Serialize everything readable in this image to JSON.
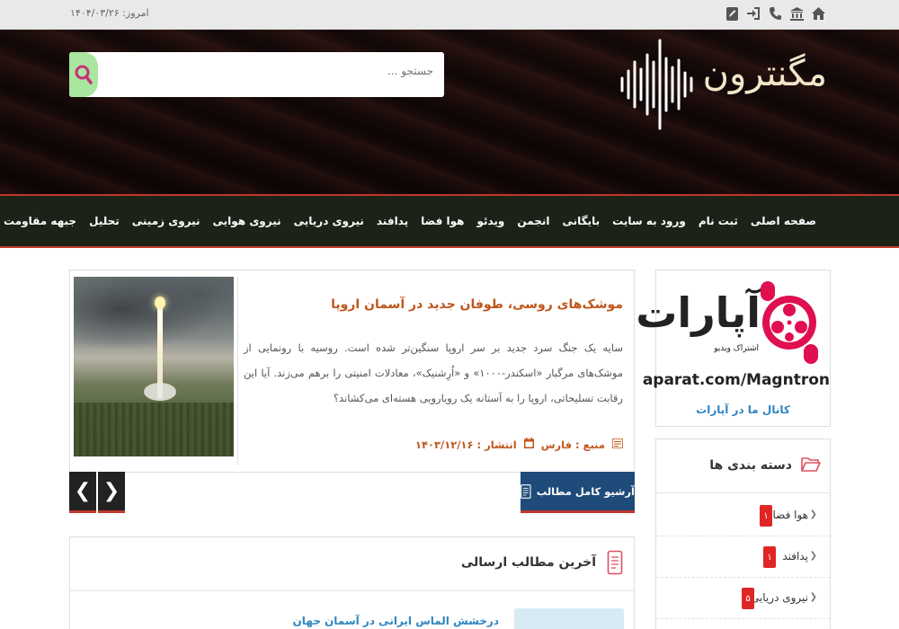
{
  "topbar": {
    "date": "امروز: ۱۴۰۴/۰۳/۲۶",
    "icons": [
      "home-icon",
      "bank-icon",
      "phone-icon",
      "login-icon",
      "edit-icon"
    ]
  },
  "header": {
    "logo_text": "مگنترون",
    "search_placeholder": "جستجو ..."
  },
  "nav": {
    "items": [
      "صفحه اصلی",
      "ثبت نام",
      "ورود به سایت",
      "بایگانی",
      "انجمن",
      "ویدئو",
      "هوا فضا",
      "پدافند",
      "نیروی دریایی",
      "نیروی هوایی",
      "نیروی زمینی",
      "تحلیل",
      "جبهه مقاومت"
    ]
  },
  "featured": {
    "title": "موشک‌های روسی، طوفان جدید در آسمان اروپا",
    "body": "سایه یک جنگ سرد جدید بر سر اروپا سنگین‌تر شده است. روسیه با رونمایی از موشک‌های مرگبار «اسکندر-۱۰۰۰» و «اُرِشنیک»، معادلات امنیتی را برهم می‌زند. آیا این رقابت تسلیحاتی، اروپا را به آستانه یک رویارویی هسته‌ای می‌کشاند؟",
    "source": "منبع : فارس",
    "published": "انتشار : ۱۴۰۳/۱۲/۱۶"
  },
  "controls": {
    "archive_label": "آرشیو کامل مطالب",
    "prev": "❮",
    "next": "❯"
  },
  "latest": {
    "title": "آخرین مطالب ارسالی",
    "first_item": "درخشش الماس ایرانی در آسمان جهان"
  },
  "aparat": {
    "word": "آپارات",
    "tagline": "اشتراک ویدیو",
    "url": "aparat.com/Magntron",
    "channel": "کانال ما در آپارات"
  },
  "categories": {
    "title": "دسته بندی ها",
    "items": [
      {
        "label": "هوا فضا",
        "count": "۱"
      },
      {
        "label": "پدافند",
        "count": "۱"
      },
      {
        "label": "نیروی دریایی",
        "count": "۵"
      }
    ]
  },
  "colors": {
    "accent_red": "#c0392b",
    "title_orange": "#c0561a",
    "nav_bg": "#1b2318",
    "archive_blue": "#1f4b7a",
    "link_blue": "#2e86c1"
  }
}
